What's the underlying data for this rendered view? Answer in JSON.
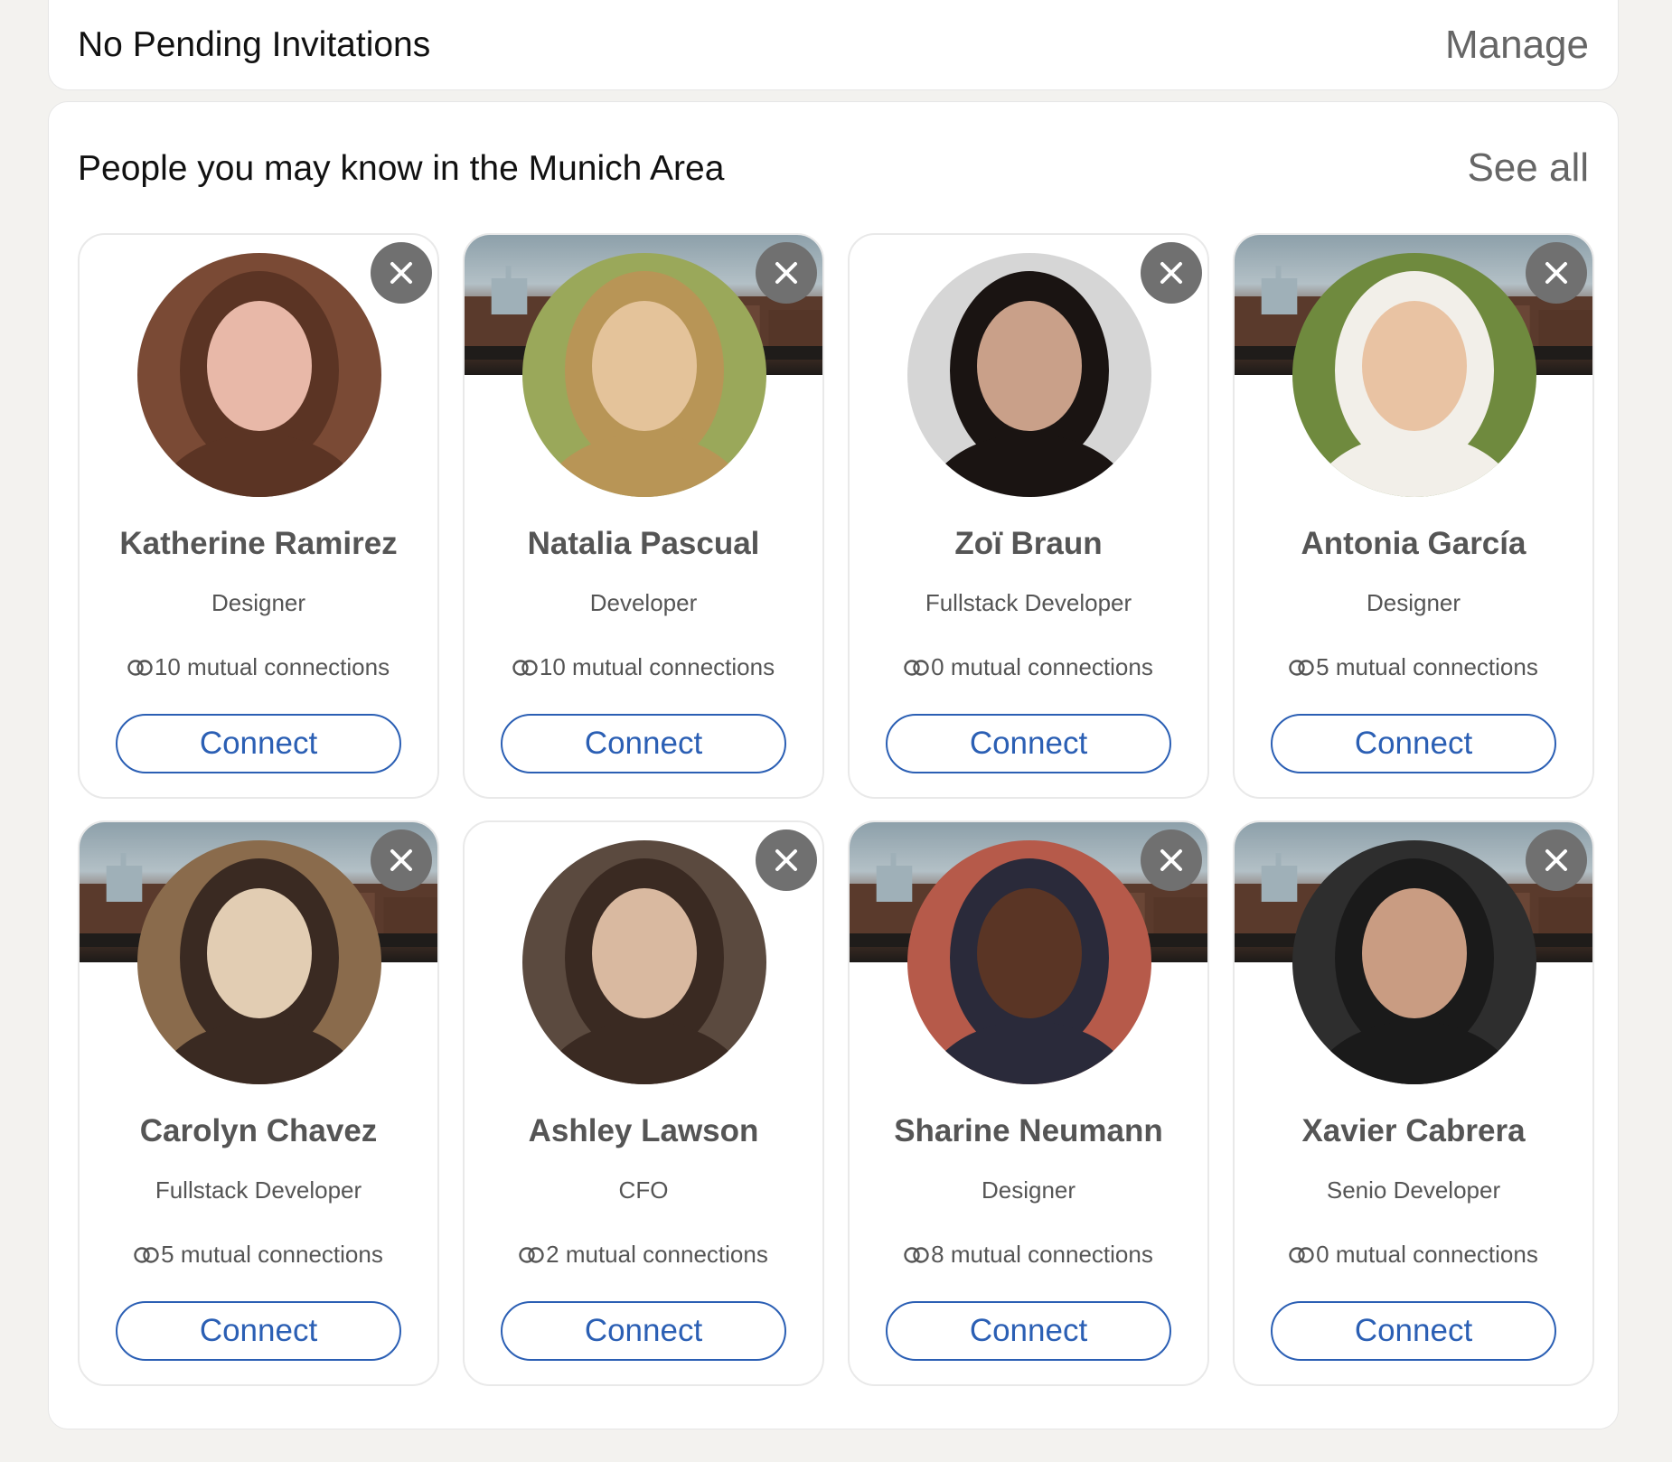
{
  "invitations": {
    "title": "No Pending Invitations",
    "manage_label": "Manage"
  },
  "suggestions": {
    "title": "People you may know in the Munich Area",
    "see_all_label": "See all",
    "connect_label": "Connect",
    "people": [
      {
        "name": "Katherine Ramirez",
        "role": "Designer",
        "mutual": "10 mutual connections",
        "banner": false,
        "avatar_colors": [
          "#7a4a35",
          "#e8b8a8",
          "#5b3424"
        ]
      },
      {
        "name": "Natalia Pascual",
        "role": "Developer",
        "mutual": "10 mutual connections",
        "banner": true,
        "avatar_colors": [
          "#9aa85a",
          "#e4c39a",
          "#b89556"
        ]
      },
      {
        "name": "Zoï Braun",
        "role": "Fullstack Developer",
        "mutual": "0 mutual connections",
        "banner": false,
        "avatar_colors": [
          "#d6d6d6",
          "#c9a089",
          "#1a1412"
        ]
      },
      {
        "name": "Antonia García",
        "role": "Designer",
        "mutual": "5 mutual connections",
        "banner": true,
        "avatar_colors": [
          "#6f8a3e",
          "#e9c3a3",
          "#f2efe9"
        ]
      },
      {
        "name": "Carolyn Chavez",
        "role": "Fullstack Developer",
        "mutual": "5 mutual connections",
        "banner": true,
        "avatar_colors": [
          "#8a6b4c",
          "#e2cdb3",
          "#3a2a22"
        ]
      },
      {
        "name": "Ashley Lawson",
        "role": "CFO",
        "mutual": "2 mutual connections",
        "banner": false,
        "avatar_colors": [
          "#5b4a3f",
          "#d9b9a0",
          "#3a2a22"
        ]
      },
      {
        "name": "Sharine Neumann",
        "role": "Designer",
        "mutual": "8 mutual connections",
        "banner": true,
        "avatar_colors": [
          "#b65a4a",
          "#5a3525",
          "#2a2a3a"
        ]
      },
      {
        "name": "Xavier Cabrera",
        "role": "Senio Developer",
        "mutual": "0 mutual connections",
        "banner": true,
        "avatar_colors": [
          "#2e2e2e",
          "#c99c82",
          "#1a1a1a"
        ]
      }
    ]
  }
}
